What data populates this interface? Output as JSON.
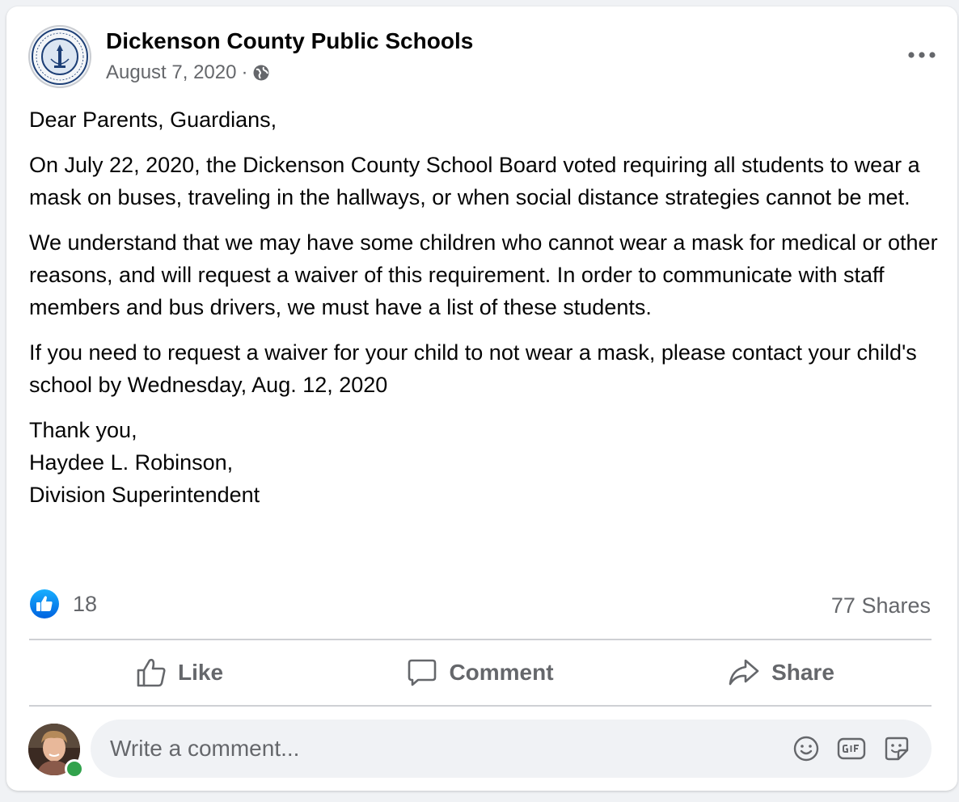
{
  "post": {
    "page_name": "Dickenson County Public Schools",
    "date": "August 7, 2020",
    "separator": "·",
    "privacy_icon": "globe-icon",
    "paragraphs": [
      "Dear Parents, Guardians,",
      "On July 22, 2020, the Dickenson County School Board voted requiring all students to wear a mask on buses, traveling in the hallways, or when social distance strategies cannot be met.",
      "We understand that we may have some children who cannot wear a mask for medical or other reasons, and will request a waiver of this requirement. In order to communicate with staff members and bus drivers, we must have a list of these students.",
      "If you need to request a waiver for your child to not wear a mask, please contact your child's school by Wednesday, Aug. 12, 2020"
    ],
    "signature": {
      "line1": "Thank you,",
      "line2": "Haydee L. Robinson,",
      "line3": "Division Superintendent"
    }
  },
  "stats": {
    "reaction_icon": "like-reaction-icon",
    "reaction_count": "18",
    "shares": "77 Shares"
  },
  "actions": {
    "like": "Like",
    "comment": "Comment",
    "share": "Share"
  },
  "comment_input": {
    "placeholder": "Write a comment...",
    "value": "",
    "icons": [
      "emoji-icon",
      "gif-icon",
      "sticker-icon"
    ]
  },
  "colors": {
    "primary_text": "#050505",
    "secondary_text": "#65676b",
    "like_blue": "#1877f2",
    "online_green": "#31a24c",
    "divider": "#ced0d4"
  }
}
